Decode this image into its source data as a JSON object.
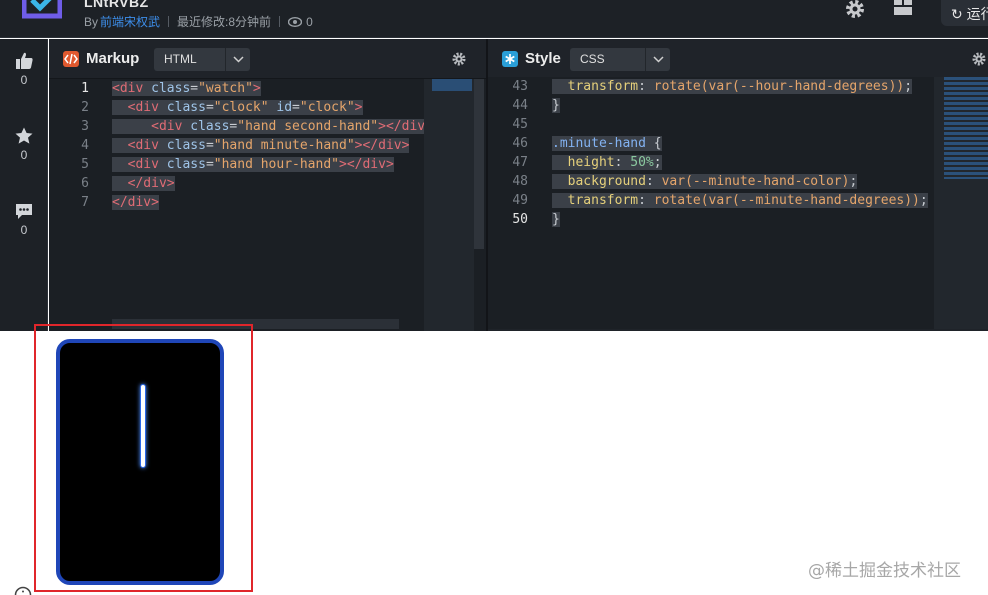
{
  "header": {
    "project_title": "LNtRVBZ",
    "author_prefix": "By",
    "author_name": "前端宋权武",
    "modified_label": "最近修改:",
    "modified_value": "8分钟前",
    "views": "0",
    "run_label": "运行"
  },
  "sidebar": {
    "likes": "0",
    "favorites": "0",
    "comments": "0"
  },
  "html_pane": {
    "title": "Markup",
    "language": "HTML",
    "line_numbers": [
      "1",
      "2",
      "3",
      "4",
      "5",
      "6",
      "7"
    ]
  },
  "css_pane": {
    "title": "Style",
    "language": "CSS",
    "line_numbers": [
      "43",
      "44",
      "45",
      "46",
      "47",
      "48",
      "49",
      "50"
    ]
  },
  "colors": {
    "accent_blue": "#1f46b8",
    "highlight_red": "#e0262b",
    "editor_bg": "#1b1f24"
  },
  "watermark": "@稀土掘金技术社区"
}
